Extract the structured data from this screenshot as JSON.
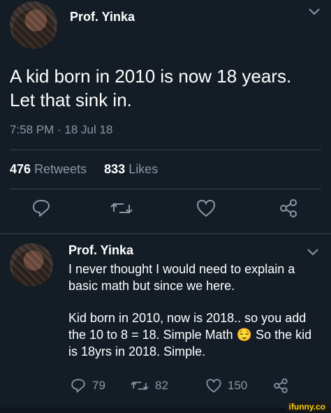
{
  "tweet": {
    "author_name": "Prof. Yinka",
    "text": "A kid born in 2010 is now 18 years. Let that sink in.",
    "timestamp": "7:58 PM · 18 Jul 18",
    "retweets_count": "476",
    "retweets_label": "Retweets",
    "likes_count": "833",
    "likes_label": "Likes"
  },
  "reply": {
    "author_name": "Prof. Yinka",
    "paragraph1": "I never thought I would need to explain a basic math but since we here.",
    "paragraph2": "Kid born in 2010, now is 2018.. so you add the 10 to 8 = 18. Simple Math 😌 So the kid is 18yrs in 2018. Simple.",
    "reply_count": "79",
    "retweet_count": "82",
    "like_count": "150"
  },
  "watermark": "ifunny.co",
  "icons": [
    "chevron-down-icon",
    "reply-icon",
    "retweet-icon",
    "like-icon",
    "share-icon"
  ],
  "colors": {
    "background": "#141d26",
    "muted": "#8899a6",
    "divider": "#38444d"
  }
}
